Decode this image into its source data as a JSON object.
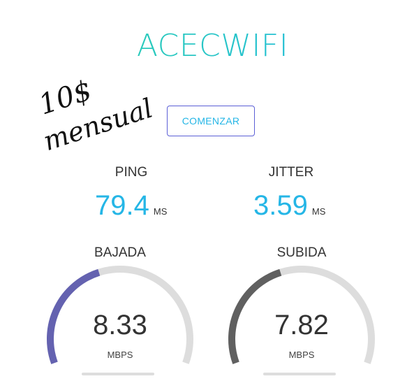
{
  "app": {
    "title": "ACECWIFI"
  },
  "note": {
    "price": "10$",
    "word": "mensual"
  },
  "start_button": {
    "label": "COMENZAR"
  },
  "ping": {
    "label": "PING",
    "value": "79.4",
    "unit": "MS"
  },
  "jitter": {
    "label": "JITTER",
    "value": "3.59",
    "unit": "MS"
  },
  "download": {
    "label": "BAJADA",
    "value": "8.33",
    "unit": "MBPS",
    "fraction": 0.42,
    "color": "#6462b0"
  },
  "upload": {
    "label": "SUBIDA",
    "value": "7.82",
    "unit": "MBPS",
    "fraction": 0.42,
    "color": "#606060"
  },
  "colors": {
    "accent": "#25b6e6",
    "title_from": "#2fd3a6",
    "title_to": "#1fb7e8",
    "button_border": "#5b5fd6",
    "track": "#dddddd"
  }
}
